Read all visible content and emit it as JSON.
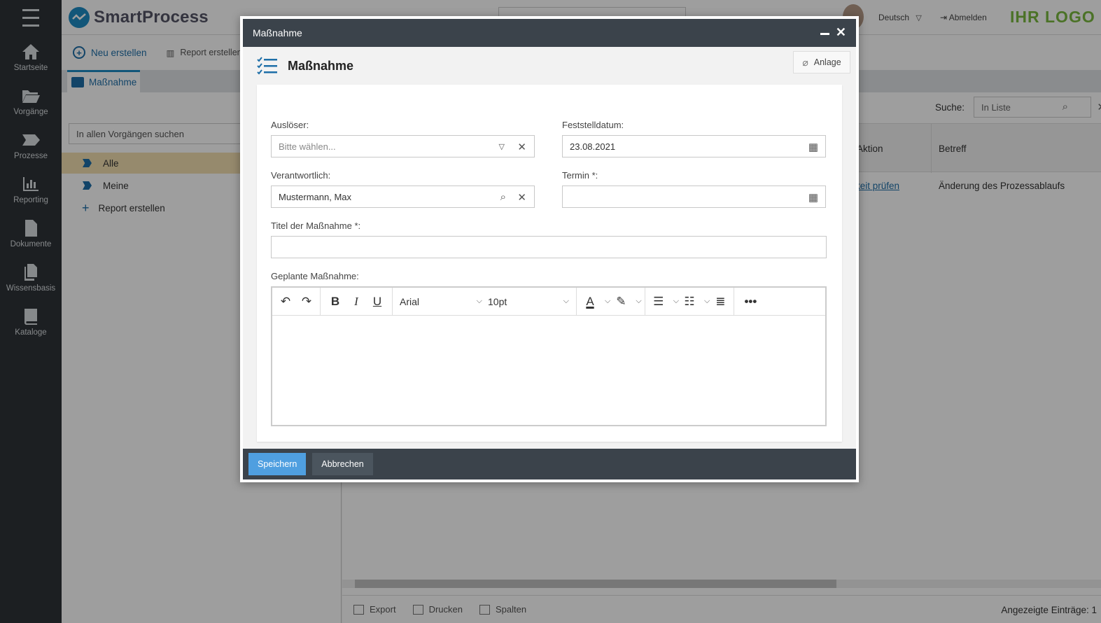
{
  "brand": {
    "name": "SmartProcess",
    "logo_text": "IHR LOGO"
  },
  "topbar": {
    "language": "Deutsch",
    "logout": "Abmelden"
  },
  "sidebar": {
    "items": [
      {
        "label": "Startseite",
        "icon": "home-icon"
      },
      {
        "label": "Vorgänge",
        "icon": "folder-icon"
      },
      {
        "label": "Prozesse",
        "icon": "process-icon"
      },
      {
        "label": "Reporting",
        "icon": "chart-icon"
      },
      {
        "label": "Dokumente",
        "icon": "document-icon"
      },
      {
        "label": "Wissensbasis",
        "icon": "documents-icon"
      },
      {
        "label": "Kataloge",
        "icon": "book-icon"
      }
    ]
  },
  "toolbar": {
    "new_label": "Neu erstellen",
    "report_label": "Report erstellen"
  },
  "tabs": [
    {
      "label": "Maßnahme"
    }
  ],
  "left_panel": {
    "search_placeholder": "In allen Vorgängen suchen",
    "tree": [
      {
        "label": "Alle"
      },
      {
        "label": "Meine"
      }
    ],
    "add_report": "Report erstellen"
  },
  "right_panel": {
    "search_label": "Suche:",
    "search_placeholder": "In Liste",
    "columns": [
      "Aktion",
      "Betreff"
    ],
    "rows": [
      {
        "aktion": "keit prüfen",
        "betreff": "Änderung des Prozessablaufs"
      }
    ],
    "footer": {
      "export": "Export",
      "print": "Drucken",
      "columns": "Spalten",
      "entries": "Angezeigte Einträge: 1"
    }
  },
  "modal": {
    "window_title": "Maßnahme",
    "heading": "Maßnahme",
    "attachment_label": "Anlage",
    "fields": {
      "ausloeser": {
        "label": "Auslöser:",
        "placeholder": "Bitte wählen..."
      },
      "feststelldatum": {
        "label": "Feststelldatum:",
        "value": "23.08.2021"
      },
      "verantwortlich": {
        "label": "Verantwortlich:",
        "value": "Mustermann, Max"
      },
      "termin": {
        "label": "Termin *:",
        "value": ""
      },
      "titel": {
        "label": "Titel der Maßnahme *:",
        "value": ""
      },
      "geplant": {
        "label": "Geplante Maßnahme:"
      }
    },
    "editor": {
      "font": "Arial",
      "size": "10pt"
    },
    "buttons": {
      "save": "Speichern",
      "cancel": "Abbrechen"
    }
  },
  "colors": {
    "accent": "#1e8bc3",
    "sidebar": "#2e3338",
    "modal_bar": "#3b434b",
    "save": "#4f9fe0",
    "logo": "#7ab93f"
  }
}
